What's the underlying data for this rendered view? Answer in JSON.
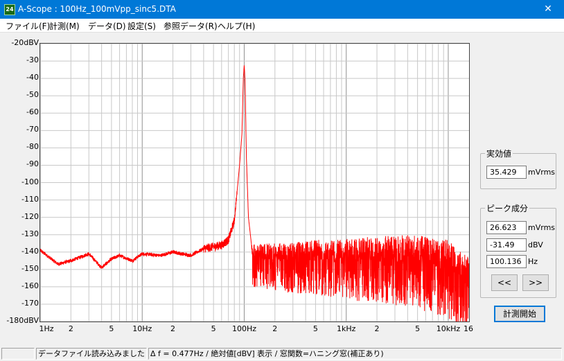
{
  "window": {
    "icon_text": "24",
    "title": "A-Scope : 100Hz_100mVpp_sinc5.DTA",
    "close_symbol": "✕"
  },
  "menu": [
    "ファイル(F)",
    "計測(M)",
    "データ(D)",
    "設定(S)",
    "参照データ(R)",
    "ヘルプ(H)"
  ],
  "rms_panel": {
    "title": "実効値",
    "value": "35.429",
    "unit": "mVrms"
  },
  "peak_panel": {
    "title": "ピーク成分",
    "rms_value": "26.623",
    "rms_unit": "mVrms",
    "dbv_value": "-31.49",
    "dbv_unit": "dBV",
    "freq_value": "100.136",
    "freq_unit": "Hz",
    "prev_label": "<<",
    "next_label": ">>"
  },
  "start_button": "計測開始",
  "status": {
    "left": "",
    "message": "データファイル読み込みました",
    "info": "Δ f = 0.477Hz / 絶対値[dBV] 表示 / 窓関数=ハニング窓(補正あり)"
  },
  "colors": {
    "trace": "#ff0000",
    "titlebar": "#0078d7",
    "grid": "#c8c8c8"
  },
  "chart_data": {
    "type": "line",
    "x_scale": "log",
    "xlim": [
      1,
      16000
    ],
    "ylim": [
      -180,
      -20
    ],
    "grid": true,
    "y_tick_labels": [
      "-20dBV",
      "-30",
      "-40",
      "-50",
      "-60",
      "-70",
      "-80",
      "-90",
      "-100",
      "-110",
      "-120",
      "-130",
      "-140",
      "-150",
      "-160",
      "-170",
      "-180dBV"
    ],
    "y_tick_values": [
      -20,
      -30,
      -40,
      -50,
      -60,
      -70,
      -80,
      -90,
      -100,
      -110,
      -120,
      -130,
      -140,
      -150,
      -160,
      -170,
      -180
    ],
    "x_tick_labels": [
      "1Hz",
      "2",
      "5",
      "10Hz",
      "2",
      "5",
      "100Hz",
      "2",
      "5",
      "1kHz",
      "2",
      "5",
      "10kHz",
      "16"
    ],
    "x_tick_values": [
      1,
      2,
      5,
      10,
      20,
      50,
      100,
      200,
      500,
      1000,
      2000,
      5000,
      10000,
      16000
    ],
    "series": [
      {
        "x": [
          1,
          1.5,
          2,
          3,
          4,
          5,
          6,
          8,
          10,
          15,
          20,
          30,
          40,
          50,
          60,
          70,
          80,
          90,
          95,
          98,
          100,
          102,
          105,
          110,
          120,
          150,
          200,
          300,
          500,
          1000,
          2000,
          5000,
          10000,
          16000
        ],
        "y": [
          -139,
          -147,
          -145,
          -141,
          -149,
          -144,
          -142,
          -145,
          -141,
          -142,
          -140,
          -142,
          -138,
          -137,
          -136,
          -133,
          -122,
          -90,
          -72,
          -40,
          -32,
          -42,
          -85,
          -120,
          -140,
          -140,
          -140,
          -140,
          -139,
          -139,
          -138,
          -138,
          -141,
          -152
        ]
      }
    ]
  }
}
